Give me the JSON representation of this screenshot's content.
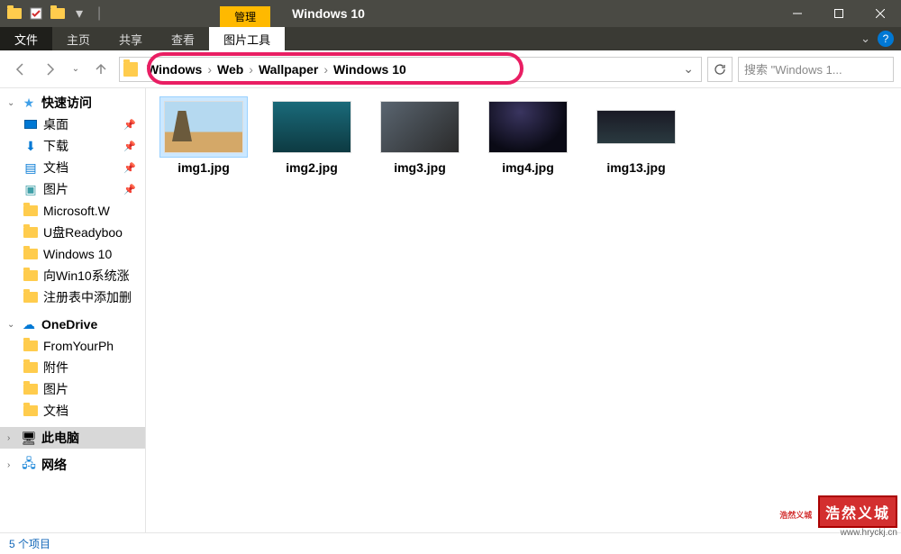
{
  "titlebar": {
    "context_tab": "管理",
    "title": "Windows 10"
  },
  "ribbon": {
    "file": "文件",
    "tabs": [
      "主页",
      "共享",
      "查看"
    ],
    "context": "图片工具"
  },
  "breadcrumb": [
    "Windows",
    "Web",
    "Wallpaper",
    "Windows 10"
  ],
  "search": {
    "placeholder": "搜索 \"Windows 1..."
  },
  "sidebar": {
    "quick_access": "快速访问",
    "quick": [
      {
        "label": "桌面",
        "icon": "desktop",
        "pinned": true
      },
      {
        "label": "下载",
        "icon": "download",
        "pinned": true
      },
      {
        "label": "文档",
        "icon": "doc",
        "pinned": true
      },
      {
        "label": "图片",
        "icon": "pic",
        "pinned": true
      },
      {
        "label": "Microsoft.W",
        "icon": "folder",
        "pinned": false
      },
      {
        "label": "U盘Readyboo",
        "icon": "folder",
        "pinned": false
      },
      {
        "label": "Windows 10",
        "icon": "folder",
        "pinned": false
      },
      {
        "label": "向Win10系统涨",
        "icon": "folder",
        "pinned": false
      },
      {
        "label": "注册表中添加删",
        "icon": "folder",
        "pinned": false
      }
    ],
    "onedrive": "OneDrive",
    "od_items": [
      {
        "label": "FromYourPh"
      },
      {
        "label": "附件"
      },
      {
        "label": "图片"
      },
      {
        "label": "文档"
      }
    ],
    "this_pc": "此电脑",
    "network": "网络"
  },
  "files": [
    {
      "name": "img1.jpg",
      "selected": true,
      "thumb_class": "thumb1"
    },
    {
      "name": "img2.jpg",
      "selected": false,
      "thumb_class": "thumb2"
    },
    {
      "name": "img3.jpg",
      "selected": false,
      "thumb_class": "thumb3"
    },
    {
      "name": "img4.jpg",
      "selected": false,
      "thumb_class": "thumb4"
    },
    {
      "name": "img13.jpg",
      "selected": false,
      "thumb_class": "thumb5"
    }
  ],
  "status": "5 个项目",
  "watermark": {
    "seal": "浩然义城",
    "tag": "浩然义城",
    "url": "www.hryckj.cn"
  }
}
